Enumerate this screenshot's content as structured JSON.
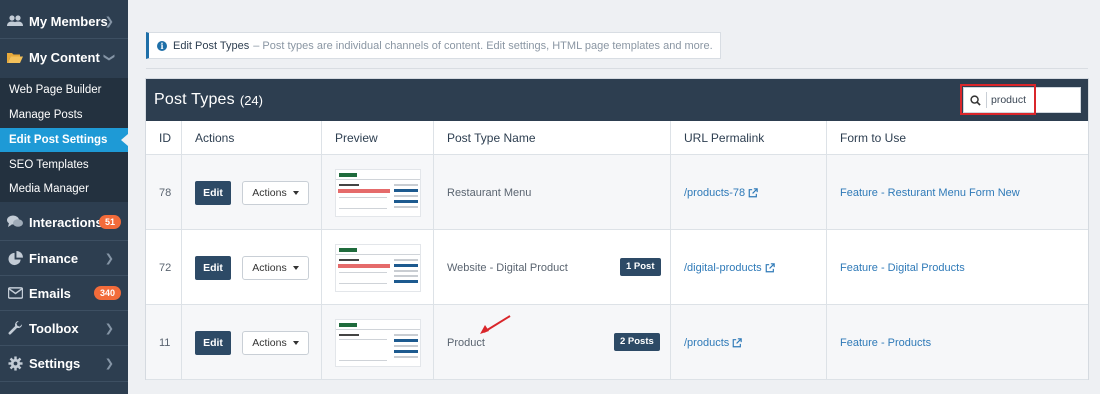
{
  "sidebar": {
    "items": [
      {
        "label": "My Members",
        "icon": "users-icon"
      },
      {
        "label": "My Content",
        "icon": "folder-open-icon"
      },
      {
        "label": "Interactions",
        "icon": "comments-icon",
        "badge": "51"
      },
      {
        "label": "Finance",
        "icon": "pie-chart-icon"
      },
      {
        "label": "Emails",
        "icon": "envelope-icon",
        "badge": "340"
      },
      {
        "label": "Toolbox",
        "icon": "wrench-icon"
      },
      {
        "label": "Settings",
        "icon": "gear-icon"
      }
    ],
    "sub_items": [
      {
        "label": "Web Page Builder"
      },
      {
        "label": "Manage Posts"
      },
      {
        "label": "Edit Post Settings",
        "active": true
      },
      {
        "label": "SEO Templates"
      },
      {
        "label": "Media Manager"
      }
    ]
  },
  "info": {
    "title": "Edit Post Types",
    "description": "– Post types are individual channels of content. Edit settings, HTML page templates and more."
  },
  "panel": {
    "title": "Post Types",
    "count": "(24)",
    "search_value": "product"
  },
  "table": {
    "headers": {
      "id": "ID",
      "actions": "Actions",
      "preview": "Preview",
      "name": "Post Type Name",
      "url": "URL Permalink",
      "form": "Form to Use"
    },
    "edit_label": "Edit",
    "actions_label": "Actions",
    "rows": [
      {
        "id": "78",
        "name": "Restaurant Menu",
        "badge": "",
        "url": "/products-78",
        "form": "Feature - Resturant Menu Form New"
      },
      {
        "id": "72",
        "name": "Website - Digital Product",
        "badge": "1 Post",
        "url": "/digital-products",
        "form": "Feature - Digital Products"
      },
      {
        "id": "11",
        "name": "Product",
        "badge": "2 Posts",
        "url": "/products",
        "form": "Feature - Products"
      }
    ]
  },
  "colors": {
    "sidebar_bg": "#2d3e50",
    "active_item": "#1e9ad6",
    "header_bg": "#2d3e50",
    "badge_orange": "#f26b3a",
    "link": "#2f7ab8",
    "highlight_red": "#d9262b"
  }
}
